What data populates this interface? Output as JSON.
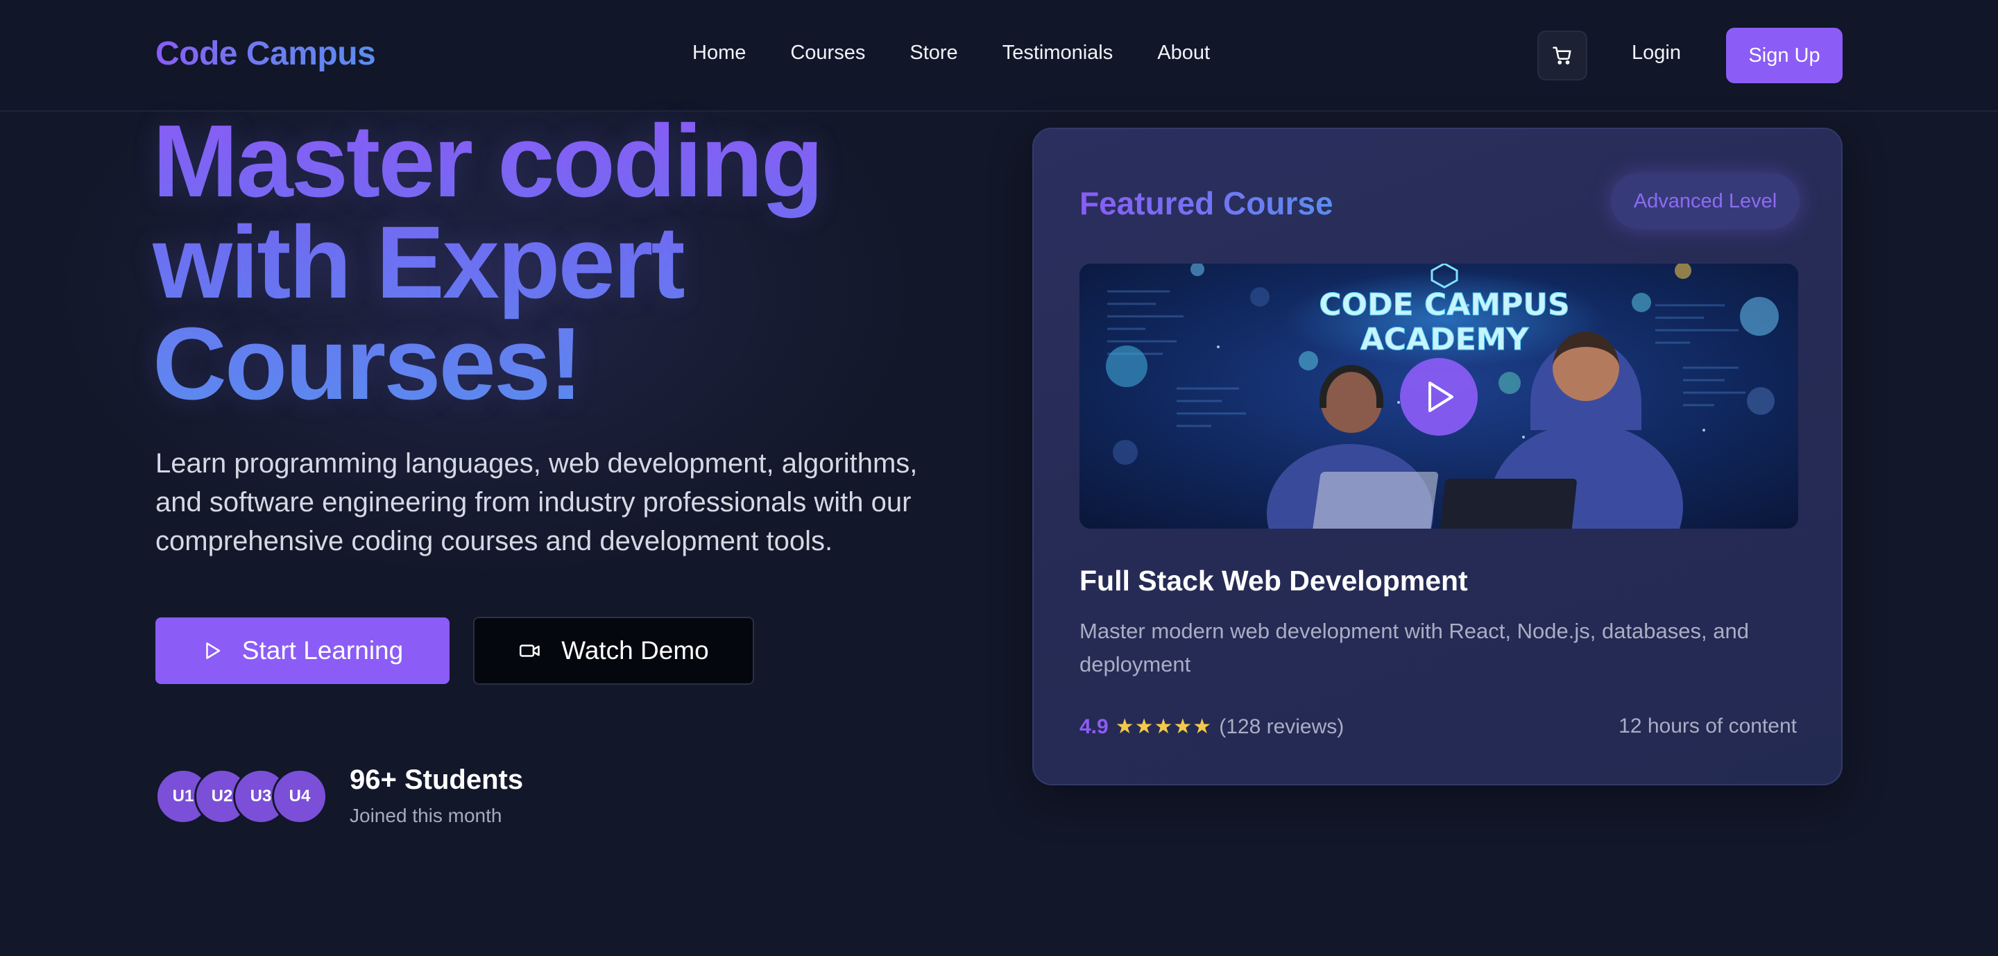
{
  "nav": {
    "logo": "Code Campus",
    "links": [
      "Home",
      "Courses",
      "Store",
      "Testimonials",
      "About"
    ],
    "cart_icon": "cart-icon",
    "login": "Login",
    "signup": "Sign Up"
  },
  "hero": {
    "title_lines": [
      "Master coding",
      "with Expert",
      "Courses!"
    ],
    "subtitle_lines": [
      "Learn programming languages, web development, algorithms,",
      "and software engineering from industry professionals with our",
      "comprehensive coding courses and development tools."
    ],
    "primary_button": {
      "label": "Start Learning",
      "icon": "play-icon"
    },
    "secondary_button": {
      "label": "Watch Demo",
      "icon": "video-icon"
    },
    "avatars": [
      "U1",
      "U2",
      "U3",
      "U4"
    ],
    "students_count": "96+ Students",
    "students_sub": "Joined this month"
  },
  "featured": {
    "label": "Featured Course",
    "level": "Advanced Level",
    "video_text": [
      "CODE CAMPUS",
      "ACADEMY"
    ],
    "video_icon": "play-icon",
    "course_title": "Full Stack Web Development",
    "description_lines": [
      "Master modern web development with React, Node.js, databases, and",
      "deployment"
    ],
    "rating": "4.9",
    "stars": "★★★★★",
    "reviews": "(128 reviews)",
    "content": "12 hours of content"
  },
  "colors": {
    "background": "#121729",
    "accent": "#8b5cf6",
    "accent_blue": "#5b8def",
    "card": "#282d59",
    "star": "#f2c94c"
  }
}
